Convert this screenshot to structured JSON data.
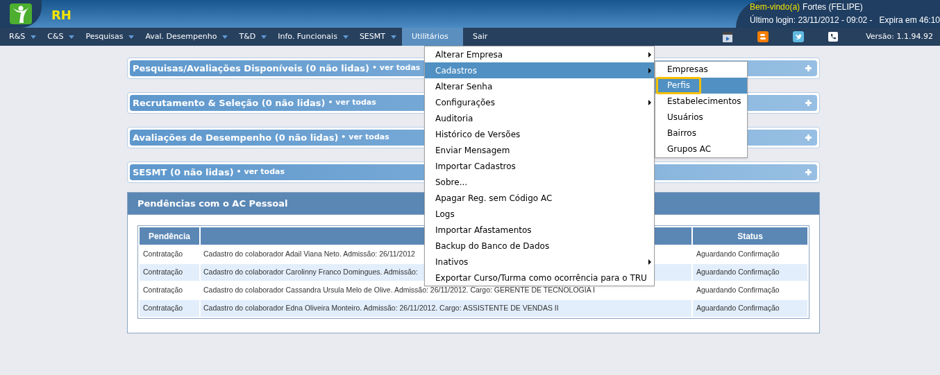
{
  "app": {
    "title": "RH"
  },
  "user": {
    "greeting": "Bem-vindo(a)",
    "name": "Fortes (FELIPE)",
    "last_login": "Último login: 23/11/2012 - 09:02 -",
    "expires": "Expira em 46:10"
  },
  "nav": [
    {
      "label": "R&S",
      "dropdown": true,
      "selected": false
    },
    {
      "label": "C&S",
      "dropdown": true,
      "selected": false
    },
    {
      "label": "Pesquisas",
      "dropdown": true,
      "selected": false
    },
    {
      "label": "Aval. Desempenho",
      "dropdown": true,
      "selected": false
    },
    {
      "label": "T&D",
      "dropdown": true,
      "selected": false
    },
    {
      "label": "Info. Funcionais",
      "dropdown": true,
      "selected": false
    },
    {
      "label": "SESMT",
      "dropdown": true,
      "selected": false
    },
    {
      "label": "Utilitários",
      "dropdown": false,
      "selected": true
    },
    {
      "label": "Sair",
      "dropdown": false,
      "selected": false
    }
  ],
  "toolbar_icons": [
    {
      "kind": "video"
    },
    {
      "kind": "blog"
    },
    {
      "kind": "bird"
    },
    {
      "kind": "phone"
    }
  ],
  "version": "Versão: 1.1.94.92",
  "panels": [
    {
      "title": "Pesquisas/Avaliações Disponíveis (0 não lidas)",
      "link": "• ver todas"
    },
    {
      "title": "Recrutamento & Seleção (0 não lidas)",
      "link": "• ver todas"
    },
    {
      "title": "Avaliações de Desempenho (0 não lidas)",
      "link": "• ver todas"
    },
    {
      "title": "SESMT (0 não lidas)",
      "link": "• ver todas"
    }
  ],
  "pendencias": {
    "title": "Pendências com o AC Pessoal",
    "columns": [
      "Pendência",
      "",
      "Status"
    ],
    "rows": [
      [
        "Contratação",
        "Cadastro do colaborador Adail Viana Neto. Admissão: 26/11/2012",
        "Aguardando Confirmação"
      ],
      [
        "Contratação",
        "Cadastro do colaborador Carolinny Franco Domingues. Admissão:",
        "Aguardando Confirmação"
      ],
      [
        "Contratação",
        "Cadastro do colaborador Cassandra Ursula Melo de Olive. Admissão: 26/11/2012. Cargo: GERENTE DE TECNOLOGIA I",
        "Aguardando Confirmação"
      ],
      [
        "Contratação",
        "Cadastro do colaborador Edna Oliveira Monteiro. Admissão: 26/11/2012. Cargo: ASSISTENTE DE VENDAS II",
        "Aguardando Confirmação"
      ]
    ]
  },
  "menu": {
    "items": [
      {
        "label": "Alterar Empresa",
        "submenu": true,
        "selected": false
      },
      {
        "label": "Cadastros",
        "submenu": true,
        "selected": true
      },
      {
        "label": "Alterar Senha",
        "submenu": false,
        "selected": false
      },
      {
        "label": "Configurações",
        "submenu": true,
        "selected": false
      },
      {
        "label": "Auditoria",
        "submenu": false,
        "selected": false
      },
      {
        "label": "Histórico de Versões",
        "submenu": false,
        "selected": false
      },
      {
        "label": "Enviar Mensagem",
        "submenu": false,
        "selected": false
      },
      {
        "label": "Importar Cadastros",
        "submenu": false,
        "selected": false
      },
      {
        "label": "Sobre...",
        "submenu": false,
        "selected": false
      },
      {
        "label": "Apagar Reg. sem Código AC",
        "submenu": false,
        "selected": false
      },
      {
        "label": "Logs",
        "submenu": false,
        "selected": false
      },
      {
        "label": "Importar Afastamentos",
        "submenu": false,
        "selected": false
      },
      {
        "label": "Backup do Banco de Dados",
        "submenu": false,
        "selected": false
      },
      {
        "label": "Inativos",
        "submenu": true,
        "selected": false
      },
      {
        "label": "Exportar Curso/Turma como ocorrência para o TRU",
        "submenu": false,
        "selected": false
      }
    ],
    "submenu": [
      {
        "label": "Empresas",
        "selected": false,
        "outlined": false
      },
      {
        "label": "Perfis",
        "selected": true,
        "outlined": true
      },
      {
        "label": "Estabelecimentos",
        "selected": false,
        "outlined": false
      },
      {
        "label": "Usuários",
        "selected": false,
        "outlined": false
      },
      {
        "label": "Bairros",
        "selected": false,
        "outlined": false
      },
      {
        "label": "Grupos AC",
        "selected": false,
        "outlined": false
      }
    ]
  }
}
